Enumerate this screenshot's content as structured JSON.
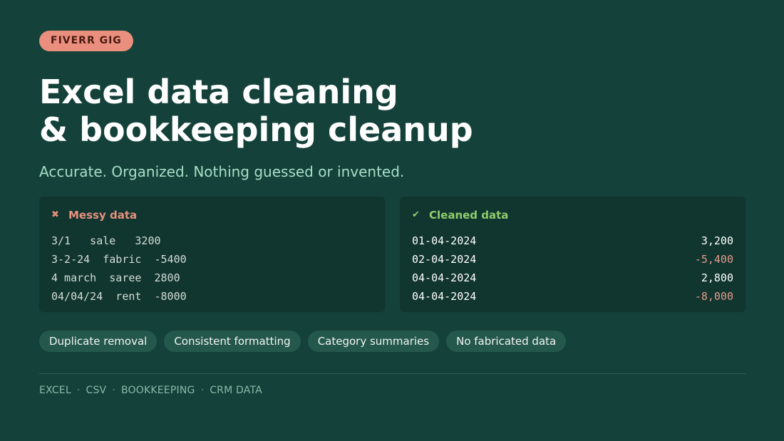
{
  "badge": "FIVERR GIG",
  "title": {
    "line1": "Excel data cleaning",
    "line2": "& bookkeeping cleanup"
  },
  "subtitle": "Accurate. Organized. Nothing guessed or invented.",
  "messy": {
    "heading": "Messy data",
    "icon": "cross-icon",
    "rows": [
      "3/1   sale   3200",
      "3-2-24  fabric  -5400",
      "4 march  saree  2800",
      "04/04/24  rent  -8000"
    ]
  },
  "clean": {
    "heading": "Cleaned data",
    "icon": "check-icon",
    "rows": [
      {
        "date": "01-04-2024",
        "amount": "3,200"
      },
      {
        "date": "02-04-2024",
        "amount": "-5,400"
      },
      {
        "date": "04-04-2024",
        "amount": "2,800"
      },
      {
        "date": "04-04-2024",
        "amount": "-8,000"
      }
    ]
  },
  "tags": [
    "Duplicate removal",
    "Consistent formatting",
    "Category summaries",
    "No fabricated data"
  ],
  "footer": {
    "items": [
      "EXCEL",
      "CSV",
      "BOOKKEEPING",
      "CRM DATA"
    ],
    "separator": "·"
  },
  "colors": {
    "background": "#14413a",
    "badge": "#ea8f7d",
    "messy_accent": "#e8917e",
    "clean_accent": "#8fcd6d",
    "negative": "#e29b8a",
    "subtitle": "#a6dfc5"
  }
}
